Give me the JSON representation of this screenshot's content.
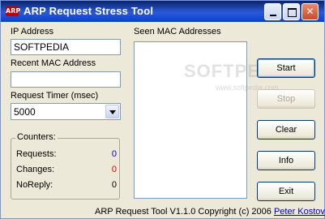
{
  "window": {
    "title": "ARP Request Stress Tool",
    "icon": "arp-app-icon",
    "icon_text": "ARP"
  },
  "ip": {
    "label": "IP Address",
    "value": "SOFTPEDIA"
  },
  "mac": {
    "label": "Recent MAC Address",
    "value": ""
  },
  "timer": {
    "label": "Request Timer (msec)",
    "selected": "5000"
  },
  "counters": {
    "title": "Counters:",
    "requests_label": "Requests:",
    "requests_value": "0",
    "changes_label": "Changes:",
    "changes_value": "0",
    "noreply_label": "NoReply:",
    "noreply_value": "0"
  },
  "seen": {
    "label": "Seen MAC Addresses"
  },
  "buttons": {
    "start": "Start",
    "stop": "Stop",
    "clear": "Clear",
    "info": "Info",
    "exit": "Exit"
  },
  "footer": {
    "text": "ARP Request Tool V1.1.0 Copyright (c) 2006 ",
    "link": "Peter Kostov"
  },
  "watermark": {
    "main": "SOFTPEDIA",
    "sub": "www.softpedia.com"
  },
  "colors": {
    "requests_value": "#0000cc",
    "changes_value": "#cc0000",
    "noreply_value": "#000000",
    "titlebar": "#0b3fcf"
  }
}
